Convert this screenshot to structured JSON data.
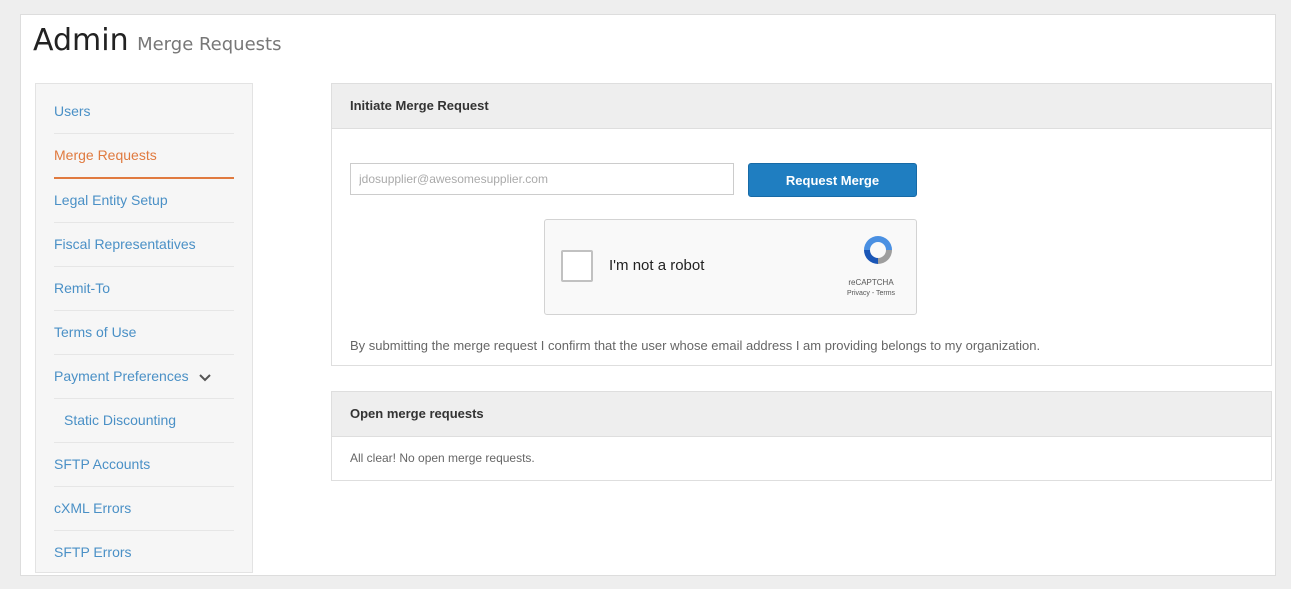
{
  "header": {
    "title": "Admin",
    "subtitle": "Merge Requests"
  },
  "sidebar": {
    "items": [
      {
        "label": "Users"
      },
      {
        "label": "Merge Requests",
        "active": true
      },
      {
        "label": "Legal Entity Setup"
      },
      {
        "label": "Fiscal Representatives"
      },
      {
        "label": "Remit-To"
      },
      {
        "label": "Terms of Use"
      },
      {
        "label": "Payment Preferences",
        "icon": "chevron-down-icon"
      },
      {
        "label": "Static Discounting",
        "sub": true
      },
      {
        "label": "SFTP Accounts"
      },
      {
        "label": "cXML Errors"
      },
      {
        "label": "SFTP Errors"
      }
    ]
  },
  "initiate_panel": {
    "heading": "Initiate Merge Request",
    "email_placeholder": "jdosupplier@awesomesupplier.com",
    "email_value": "",
    "button_label": "Request Merge",
    "captcha": {
      "label": "I'm not a robot",
      "brand": "reCAPTCHA",
      "links": "Privacy - Terms"
    },
    "disclaimer": "By submitting the merge request I confirm that the user whose email address I am providing belongs to my organization."
  },
  "open_panel": {
    "heading": "Open merge requests",
    "empty_text": "All clear! No open merge requests."
  },
  "colors": {
    "accent": "#1f7ec1",
    "link": "#4a90c6",
    "active": "#e07a3f"
  }
}
